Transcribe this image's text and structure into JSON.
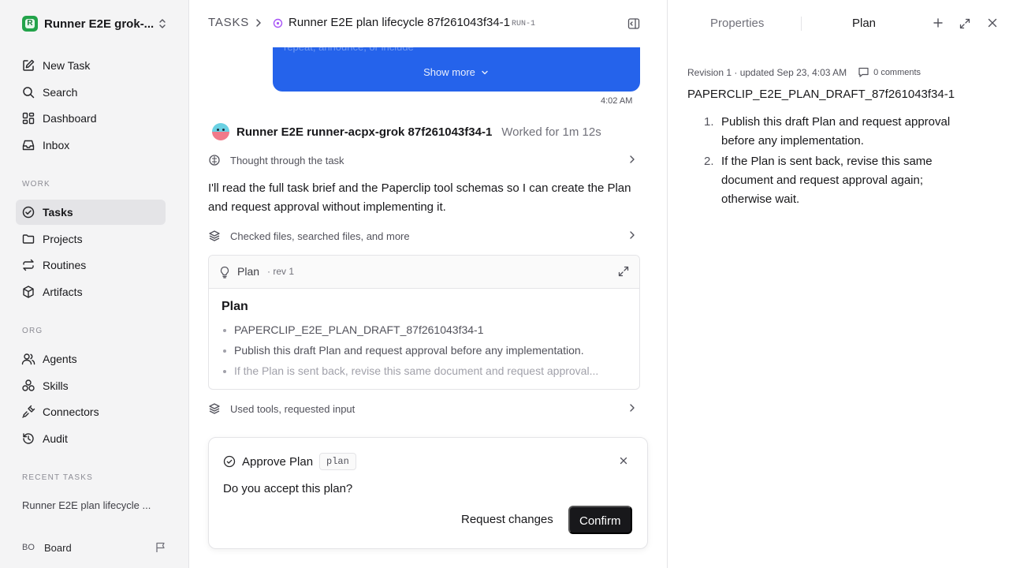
{
  "workspace": {
    "logo_letter": "R",
    "name": "Runner E2E grok-...",
    "logo_color": "#22a34a"
  },
  "nav": {
    "new_task": "New Task",
    "search": "Search",
    "dashboard": "Dashboard",
    "inbox": "Inbox",
    "work_label": "WORK",
    "tasks": "Tasks",
    "projects": "Projects",
    "routines": "Routines",
    "artifacts": "Artifacts",
    "org_label": "ORG",
    "agents": "Agents",
    "skills": "Skills",
    "connectors": "Connectors",
    "audit": "Audit",
    "recent_label": "RECENT TASKS",
    "recent_item": "Runner E2E plan lifecycle ..."
  },
  "user": {
    "initials": "BO",
    "name": "Board"
  },
  "breadcrumb": {
    "root": "TASKS",
    "title": "Runner E2E plan lifecycle 87f261043f34-1",
    "run": "RUN-1"
  },
  "thread": {
    "bubble_faded": "repeat, announce, or include",
    "show_more": "Show more",
    "bubble_time": "4:02 AM",
    "agent_name": "Runner E2E runner-acpx-grok 87f261043f34-1",
    "worked": "Worked for 1m 12s",
    "thought": "Thought through the task",
    "message": "I'll read the full task brief and the Paperclip tool schemas so I can create the Plan and request approval without implementing it.",
    "checked": "Checked files, searched files, and more",
    "used_tools": "Used tools, requested input"
  },
  "plan_card": {
    "label": "Plan",
    "rev": "· rev 1",
    "heading": "Plan",
    "items": [
      "PAPERCLIP_E2E_PLAN_DRAFT_87f261043f34-1",
      "Publish this draft Plan and request approval before any implementation.",
      "If the Plan is sent back, revise this same document and request approval..."
    ]
  },
  "approval": {
    "title": "Approve Plan",
    "tag": "plan",
    "question": "Do you accept this plan?",
    "request_changes": "Request changes",
    "confirm": "Confirm"
  },
  "right_panel": {
    "tab_properties": "Properties",
    "tab_plan": "Plan",
    "revision": "Revision 1 · updated Sep 23, 4:03 AM",
    "comments": "0 comments",
    "doc_title": "PAPERCLIP_E2E_PLAN_DRAFT_87f261043f34-1",
    "steps": [
      {
        "num": "1.",
        "text": "Publish this draft Plan and request approval before any implementation."
      },
      {
        "num": "2.",
        "text": "If the Plan is sent back, revise this same document and request approval again; otherwise wait."
      }
    ]
  },
  "colors": {
    "accent_blue": "#2563eb",
    "sidebar_bg": "#f4f4f5",
    "status_purple": "#a855f7"
  }
}
